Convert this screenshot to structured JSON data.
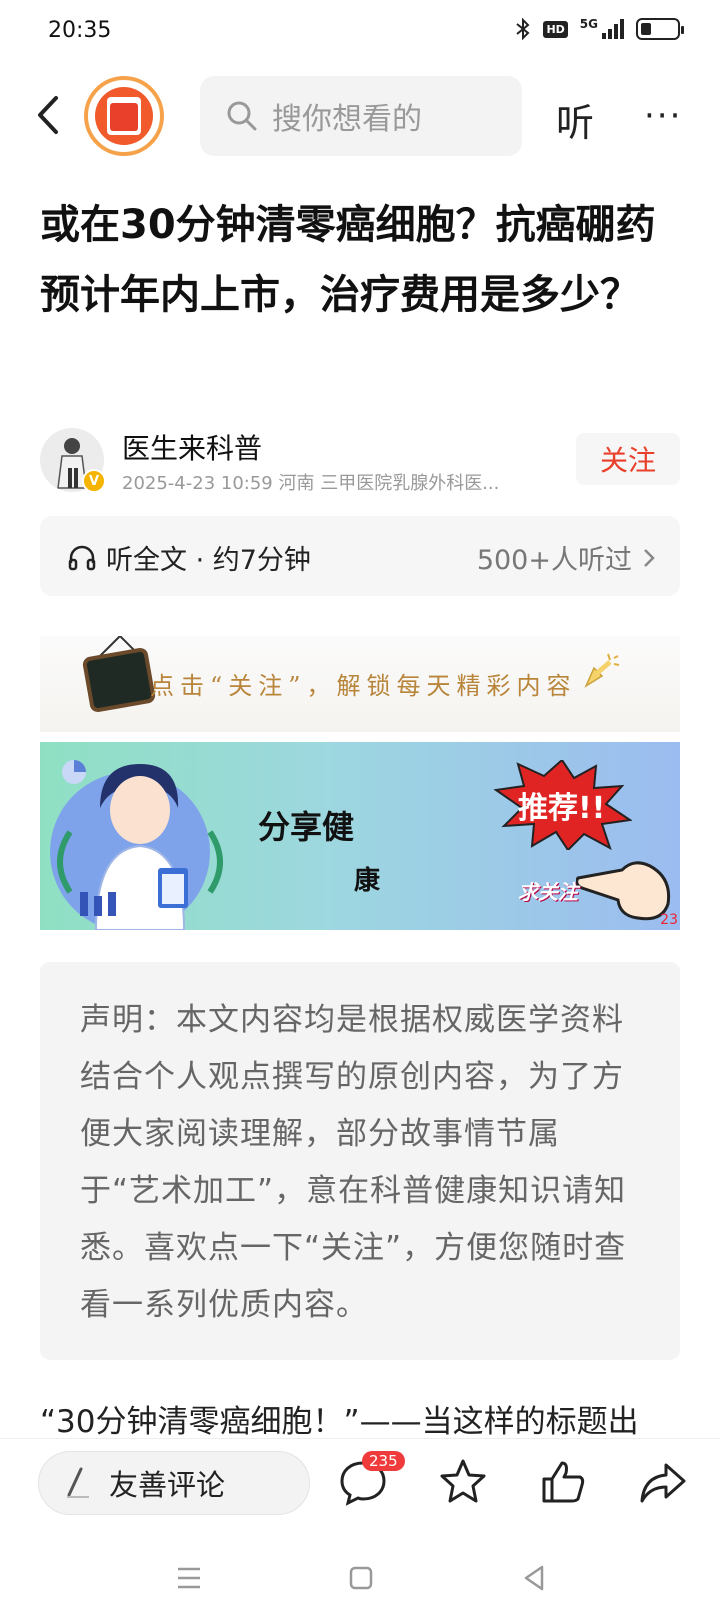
{
  "status_bar": {
    "time": "20:35",
    "network": "5G",
    "hd": "HD",
    "battery_percent": 30
  },
  "topbar": {
    "search_placeholder": "搜你想看的",
    "listen_label": "听",
    "more_label": "···"
  },
  "article": {
    "title": "或在30分钟清零癌细胞？抗癌硼药预计年内上市，治疗费用是多少？",
    "author_name": "医生来科普",
    "verified_badge": "V",
    "meta": "2025-4-23  10:59  河南  三甲医院乳腺外科医...",
    "follow_label": "关注",
    "listen_full": "听全文 · 约7分钟",
    "listeners": "500+人听过"
  },
  "banners": {
    "follow_banner_text": "点击“关注”，解锁每天精彩内容",
    "health_line1": "分享健",
    "health_line2": "康",
    "recommend_text": "推荐!!",
    "ask_follow_text": "求关注",
    "corner_number": "23"
  },
  "declaration": "声明：本文内容均是根据权威医学资料结合个人观点撰写的原创内容，为了方便大家阅读理解，部分故事情节属于“艺术加工”，意在科普健康知识请知悉。喜欢点一下“关注”，方便您随时查看一系列优质内容。",
  "first_paragraph": "“30分钟清零癌细胞！”——当这样的标题出",
  "bottom_bar": {
    "comment_placeholder": "友善评论",
    "comment_count": "235"
  },
  "colors": {
    "accent_red": "#e8402a",
    "badge_red": "#ef3b3b",
    "logo_orange": "#f15a2b"
  }
}
